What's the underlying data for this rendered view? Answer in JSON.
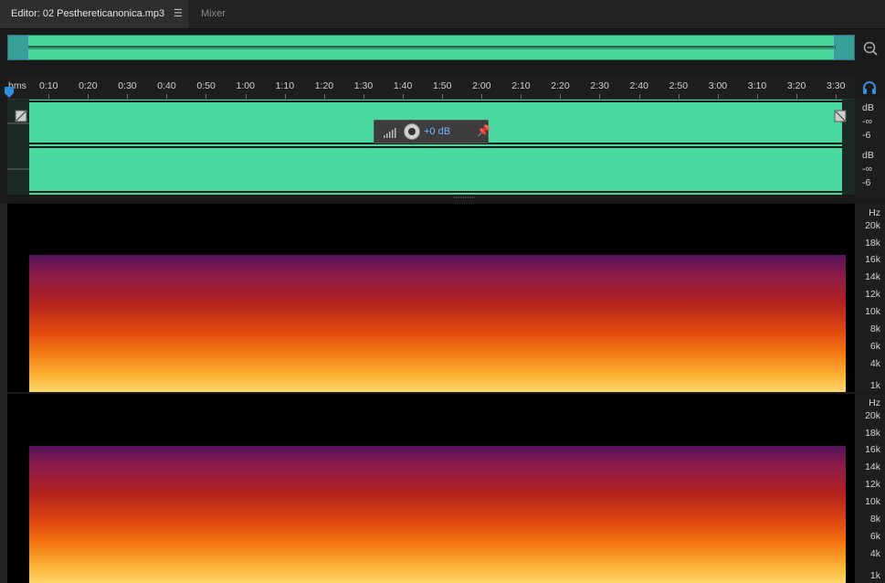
{
  "tabs": [
    {
      "label": "Editor: 02 Pesthereticanonica.mp3",
      "active": true
    },
    {
      "label": "Mixer",
      "active": false
    }
  ],
  "ruler": {
    "unit": "hms",
    "labels": [
      "0:10",
      "0:20",
      "0:30",
      "0:40",
      "0:50",
      "1:00",
      "1:10",
      "1:20",
      "1:30",
      "1:40",
      "1:50",
      "2:00",
      "2:10",
      "2:20",
      "2:30",
      "2:40",
      "2:50",
      "3:00",
      "3:10",
      "3:20",
      "3:30"
    ]
  },
  "hud": {
    "value": "+0 dB"
  },
  "db_scale": [
    {
      "label": "dB"
    },
    {
      "label": "-∞"
    },
    {
      "label": "-6"
    },
    {
      "label": "dB"
    },
    {
      "label": "-∞"
    },
    {
      "label": "-6"
    }
  ],
  "hz_scale": [
    "Hz",
    "20k",
    "18k",
    "16k",
    "14k",
    "12k",
    "10k",
    "8k",
    "6k",
    "4k",
    "1k"
  ],
  "colors": {
    "waveform": "#49d99f",
    "accent": "#2e8fe0"
  }
}
